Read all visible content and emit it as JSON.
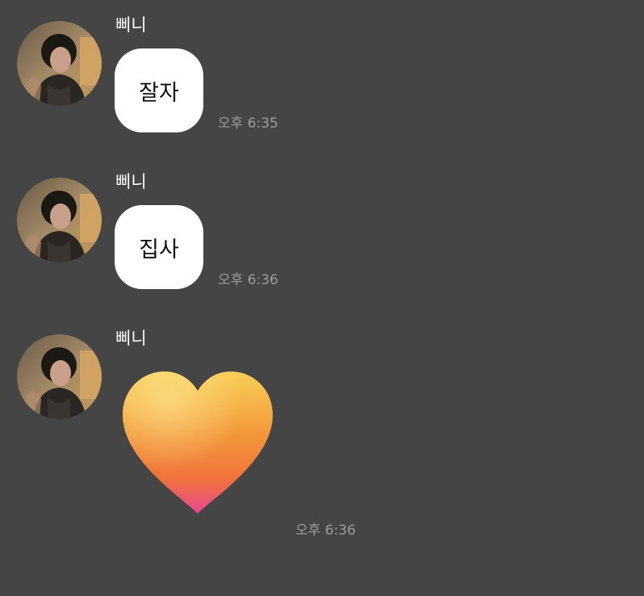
{
  "messages": [
    {
      "sender": "삐니",
      "text": "잘자",
      "time": "오후 6:35"
    },
    {
      "sender": "삐니",
      "text": "집사",
      "time": "오후 6:36"
    },
    {
      "sender": "삐니",
      "sticker": "orange-heart-emoji",
      "time": "오후 6:36"
    }
  ],
  "colors": {
    "background": "#454545",
    "bubble": "#ffffff",
    "timestamp": "#9c9c9c",
    "heart_top": "#f9c64e",
    "heart_mid": "#f08a32",
    "heart_bottom": "#ec4e86"
  }
}
